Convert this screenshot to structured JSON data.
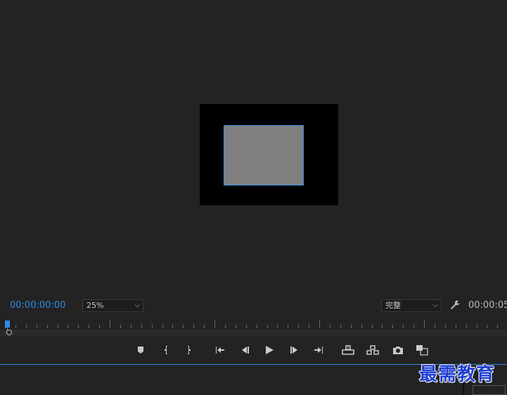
{
  "monitor": {
    "current_timecode": "00:00:00:00",
    "zoom_select": {
      "value": "25%"
    },
    "quality_select": {
      "value": "完整"
    },
    "duration_timecode": "00:00:05"
  },
  "transport_controls": [
    {
      "name": "add-marker-button",
      "icon": "marker-icon"
    },
    {
      "name": "mark-in-button",
      "icon": "mark-in-icon"
    },
    {
      "name": "mark-out-button",
      "icon": "mark-out-icon"
    },
    {
      "name": "go-to-in-button",
      "icon": "go-to-in-icon"
    },
    {
      "name": "step-back-button",
      "icon": "step-back-icon"
    },
    {
      "name": "play-button",
      "icon": "play-icon"
    },
    {
      "name": "step-forward-button",
      "icon": "step-forward-icon"
    },
    {
      "name": "go-to-out-button",
      "icon": "go-to-out-icon"
    },
    {
      "name": "lift-button",
      "icon": "lift-icon"
    },
    {
      "name": "extract-button",
      "icon": "extract-icon"
    },
    {
      "name": "export-frame-button",
      "icon": "camera-icon"
    },
    {
      "name": "comparison-view-button",
      "icon": "comparison-icon"
    }
  ],
  "colors": {
    "accent": "#2d8ceb",
    "panel_bg": "#232323",
    "canvas_bg": "#000000",
    "clip_fill": "#808080"
  },
  "watermark": "最需教育"
}
